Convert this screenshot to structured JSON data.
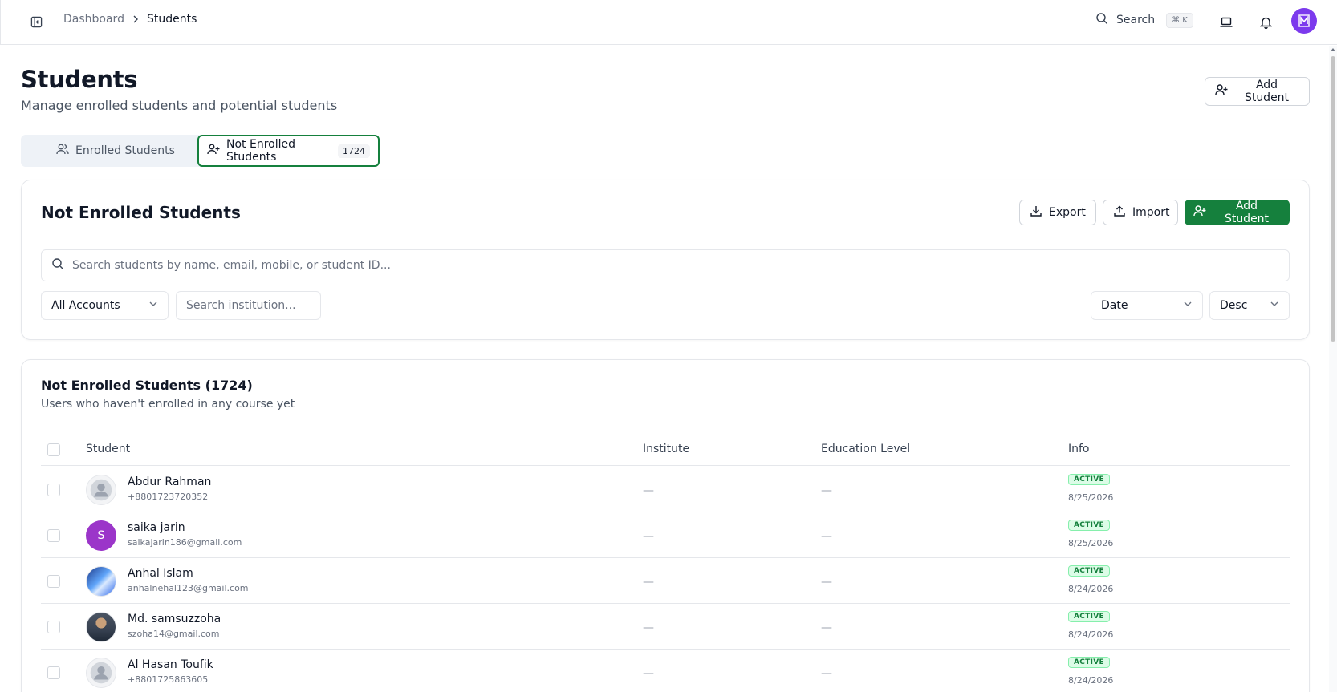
{
  "breadcrumb": {
    "home": "Dashboard",
    "current": "Students"
  },
  "topbar": {
    "search_label": "Search",
    "shortcut": "⌘ K",
    "avatar_initial": "M"
  },
  "header": {
    "title": "Students",
    "subtitle": "Manage enrolled students and potential students",
    "add_button": "Add Student"
  },
  "tabs": {
    "enrolled": "Enrolled Students",
    "not_enrolled": "Not Enrolled Students",
    "not_enrolled_count": "1724"
  },
  "filter_card": {
    "title": "Not Enrolled Students",
    "export": "Export",
    "import": "Import",
    "add": "Add Student",
    "search_placeholder": "Search students by name, email, mobile, or student ID...",
    "accounts_value": "All Accounts",
    "institution_placeholder": "Search institution...",
    "sort_field": "Date",
    "sort_order": "Desc"
  },
  "list": {
    "title": "Not Enrolled Students (1724)",
    "subtitle": "Users who haven't enrolled in any course yet",
    "columns": {
      "student": "Student",
      "institute": "Institute",
      "education": "Education Level",
      "info": "Info"
    },
    "rows": [
      {
        "name": "Abdur Rahman",
        "contact": "+8801723720352",
        "institute": "—",
        "education": "—",
        "status": "ACTIVE",
        "date": "8/25/2026"
      },
      {
        "name": "saika jarin",
        "contact": "saikajarin186@gmail.com",
        "initial": "S",
        "institute": "—",
        "education": "—",
        "status": "ACTIVE",
        "date": "8/25/2026"
      },
      {
        "name": "Anhal Islam",
        "contact": "anhalnehal123@gmail.com",
        "institute": "—",
        "education": "—",
        "status": "ACTIVE",
        "date": "8/24/2026"
      },
      {
        "name": "Md. samsuzzoha",
        "contact": "szoha14@gmail.com",
        "institute": "—",
        "education": "—",
        "status": "ACTIVE",
        "date": "8/24/2026"
      },
      {
        "name": "Al Hasan Toufik",
        "contact": "+8801725863605",
        "institute": "—",
        "education": "—",
        "status": "ACTIVE",
        "date": "8/24/2026"
      }
    ]
  },
  "colors": {
    "primary": "#15803d",
    "avatar_purple": "#7c3aed",
    "badge_bg": "#dcfce7"
  }
}
